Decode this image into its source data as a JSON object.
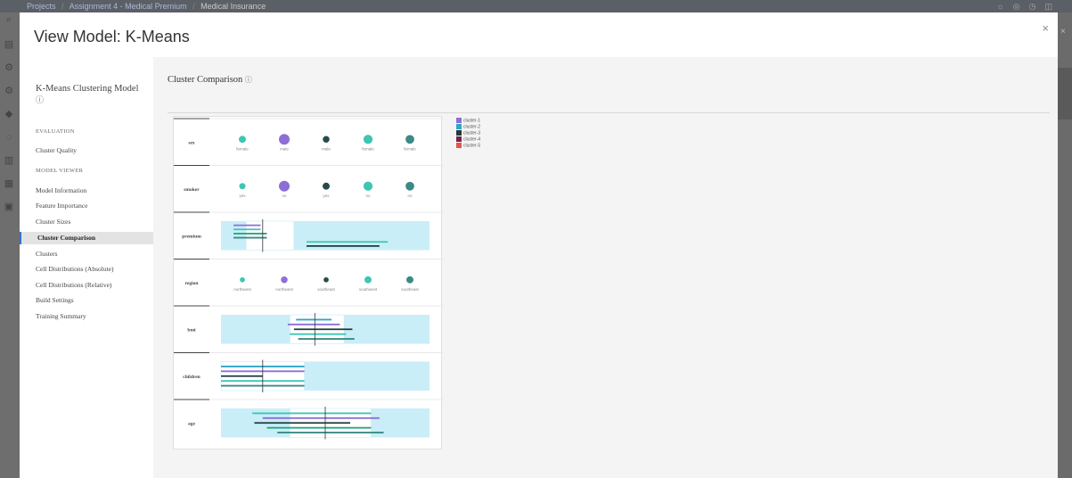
{
  "background": {
    "breadcrumb": [
      "Projects",
      "Assignment 4 - Medical Premium",
      "Medical Insurance"
    ]
  },
  "modal": {
    "title": "View Model: K-Means",
    "close_label": "×"
  },
  "sidenav": {
    "model_title": "K-Means Clustering Model",
    "info_icon": "ⓘ",
    "sections": [
      {
        "label": "EVALUATION",
        "items": [
          {
            "label": "Cluster Quality"
          }
        ]
      },
      {
        "label": "MODEL VIEWER",
        "items": [
          {
            "label": "Model Information"
          },
          {
            "label": "Feature Importance"
          },
          {
            "label": "Cluster Sizes"
          },
          {
            "label": "Cluster Comparison",
            "active": true
          },
          {
            "label": "Clusters"
          },
          {
            "label": "Cell Distributions (Absolute)"
          },
          {
            "label": "Cell Distributions (Relative)"
          },
          {
            "label": "Build Settings"
          },
          {
            "label": "Training Summary"
          }
        ]
      }
    ]
  },
  "content": {
    "title": "Cluster Comparison",
    "info_icon": "ⓘ"
  },
  "chart_data": {
    "type": "table",
    "title": "Cluster Comparison",
    "legend": [
      "cluster-1",
      "cluster-2",
      "cluster-3",
      "cluster-4",
      "cluster-5"
    ],
    "legend_placement": "top-right",
    "colors": [
      "#8e6fd8",
      "#2fa6c7",
      "#1f3b3b",
      "#7a1f4a",
      "#e2554e",
      "#3ec6b3",
      "#3b8a86",
      "#2aa67f"
    ],
    "categorical_rows": [
      {
        "feature": "sex",
        "cells": [
          {
            "label": "female",
            "size": 0.55,
            "color": "#3ec6b3"
          },
          {
            "label": "male",
            "size": 1.0,
            "color": "#8e6fd8"
          },
          {
            "label": "male",
            "size": 0.5,
            "color": "#2a4a4a"
          },
          {
            "label": "female",
            "size": 0.8,
            "color": "#3ec6b3"
          },
          {
            "label": "female",
            "size": 0.75,
            "color": "#3b8a86"
          }
        ]
      },
      {
        "feature": "smoker",
        "cells": [
          {
            "label": "yes",
            "size": 0.45,
            "color": "#3ec6b3"
          },
          {
            "label": "no",
            "size": 1.0,
            "color": "#8e6fd8"
          },
          {
            "label": "yes",
            "size": 0.55,
            "color": "#2a4a4a"
          },
          {
            "label": "no",
            "size": 0.8,
            "color": "#3ec6b3"
          },
          {
            "label": "no",
            "size": 0.75,
            "color": "#3b8a86"
          }
        ]
      },
      {
        "feature": "region",
        "cells": [
          {
            "label": "northwest",
            "size": 0.3,
            "color": "#3ec6b3"
          },
          {
            "label": "northwest",
            "size": 0.5,
            "color": "#8e6fd8"
          },
          {
            "label": "southeast",
            "size": 0.3,
            "color": "#2a4a4a"
          },
          {
            "label": "southwest",
            "size": 0.55,
            "color": "#3ec6b3"
          },
          {
            "label": "southeast",
            "size": 0.55,
            "color": "#3b8a86"
          }
        ]
      }
    ],
    "continuous_rows": [
      {
        "feature": "premium",
        "box": [
          0.12,
          0.35
        ],
        "median": 0.2,
        "bars": [
          {
            "from": 0.06,
            "to": 0.19,
            "color": "#8e6fd8"
          },
          {
            "from": 0.06,
            "to": 0.19,
            "color": "#3ec6b3"
          },
          {
            "from": 0.06,
            "to": 0.22,
            "color": "#2aa67f"
          },
          {
            "from": 0.06,
            "to": 0.22,
            "color": "#3b8a86"
          },
          {
            "from": 0.41,
            "to": 0.8,
            "color": "#3ec6b3"
          },
          {
            "from": 0.41,
            "to": 0.76,
            "color": "#1f3b3b"
          }
        ]
      },
      {
        "feature": "bmi",
        "box": [
          0.33,
          0.59
        ],
        "median": 0.45,
        "bars": [
          {
            "from": 0.36,
            "to": 0.53,
            "color": "#2fa6c7"
          },
          {
            "from": 0.32,
            "to": 0.57,
            "color": "#8e6fd8"
          },
          {
            "from": 0.35,
            "to": 0.63,
            "color": "#1f3b3b"
          },
          {
            "from": 0.33,
            "to": 0.6,
            "color": "#3ec6b3"
          },
          {
            "from": 0.37,
            "to": 0.64,
            "color": "#3b8a86"
          }
        ]
      },
      {
        "feature": "children",
        "box": [
          0.0,
          0.4
        ],
        "median": 0.2,
        "bars": [
          {
            "from": 0.0,
            "to": 0.4,
            "color": "#2fa6c7"
          },
          {
            "from": 0.0,
            "to": 0.4,
            "color": "#8e6fd8"
          },
          {
            "from": 0.0,
            "to": 0.2,
            "color": "#1f3b3b"
          },
          {
            "from": 0.0,
            "to": 0.4,
            "color": "#3ec6b3"
          },
          {
            "from": 0.0,
            "to": 0.4,
            "color": "#3b8a86"
          }
        ]
      },
      {
        "feature": "age",
        "box": [
          0.33,
          0.72
        ],
        "median": 0.5,
        "bars": [
          {
            "from": 0.15,
            "to": 0.72,
            "color": "#3ec6b3"
          },
          {
            "from": 0.2,
            "to": 0.76,
            "color": "#8e6fd8"
          },
          {
            "from": 0.16,
            "to": 0.62,
            "color": "#1f3b3b"
          },
          {
            "from": 0.22,
            "to": 0.72,
            "color": "#2aa67f"
          },
          {
            "from": 0.27,
            "to": 0.78,
            "color": "#3b8a86"
          }
        ]
      }
    ],
    "row_order": [
      "sex",
      "smoker",
      "premium",
      "region",
      "bmi",
      "children",
      "age"
    ]
  }
}
